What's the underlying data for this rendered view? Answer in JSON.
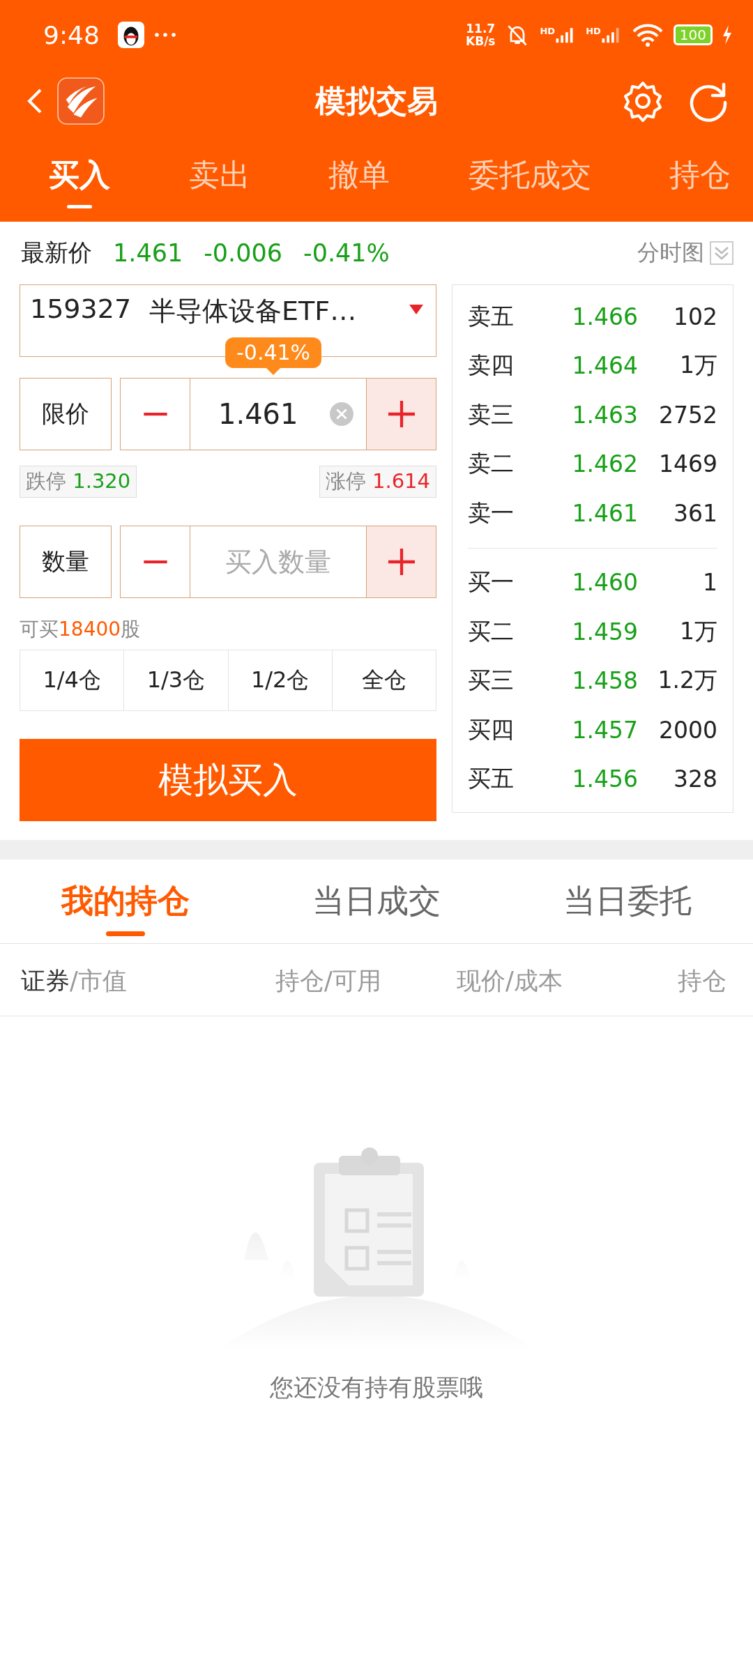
{
  "status_bar": {
    "time": "9:48",
    "net_speed_value": "11.7",
    "net_speed_unit": "KB/s",
    "sim_labels": [
      "HD",
      "HD"
    ],
    "battery": "100"
  },
  "header": {
    "title": "模拟交易"
  },
  "tabs": [
    {
      "label": "买入",
      "selected": true
    },
    {
      "label": "卖出",
      "selected": false
    },
    {
      "label": "撤单",
      "selected": false
    },
    {
      "label": "委托成交",
      "selected": false
    },
    {
      "label": "持仓",
      "selected": false
    }
  ],
  "quote": {
    "label": "最新价",
    "price": "1.461",
    "change": "-0.006",
    "change_pct": "-0.41%",
    "chart_toggle": "分时图"
  },
  "stock_select": {
    "code": "159327",
    "name": "半导体设备ETF…"
  },
  "price_field": {
    "label": "限价",
    "value": "1.461",
    "tooltip": "-0.41%"
  },
  "limits": {
    "down_label": "跌停",
    "down_value": "1.320",
    "up_label": "涨停",
    "up_value": "1.614"
  },
  "quantity_field": {
    "label": "数量",
    "placeholder": "买入数量"
  },
  "buyable": {
    "prefix": "可买",
    "amount": "18400",
    "unit": "股"
  },
  "position_buttons": [
    "1/4仓",
    "1/3仓",
    "1/2仓",
    "全仓"
  ],
  "submit": "模拟买入",
  "order_book": {
    "asks": [
      {
        "label": "卖五",
        "price": "1.466",
        "volume": "102"
      },
      {
        "label": "卖四",
        "price": "1.464",
        "volume": "1万"
      },
      {
        "label": "卖三",
        "price": "1.463",
        "volume": "2752"
      },
      {
        "label": "卖二",
        "price": "1.462",
        "volume": "1469"
      },
      {
        "label": "卖一",
        "price": "1.461",
        "volume": "361"
      }
    ],
    "bids": [
      {
        "label": "买一",
        "price": "1.460",
        "volume": "1"
      },
      {
        "label": "买二",
        "price": "1.459",
        "volume": "1万"
      },
      {
        "label": "买三",
        "price": "1.458",
        "volume": "1.2万"
      },
      {
        "label": "买四",
        "price": "1.457",
        "volume": "2000"
      },
      {
        "label": "买五",
        "price": "1.456",
        "volume": "328"
      }
    ]
  },
  "holdings_tabs": [
    {
      "label": "我的持仓",
      "selected": true
    },
    {
      "label": "当日成交",
      "selected": false
    },
    {
      "label": "当日委托",
      "selected": false
    }
  ],
  "table": {
    "columns": [
      {
        "label": "证券",
        "suffix": "/市值",
        "active": true
      },
      {
        "label": "持仓/可用",
        "active": false
      },
      {
        "label": "现价/成本",
        "active": false
      },
      {
        "label": "持仓",
        "active": false
      }
    ]
  },
  "empty_state": {
    "message": "您还没有持有股票哦"
  }
}
